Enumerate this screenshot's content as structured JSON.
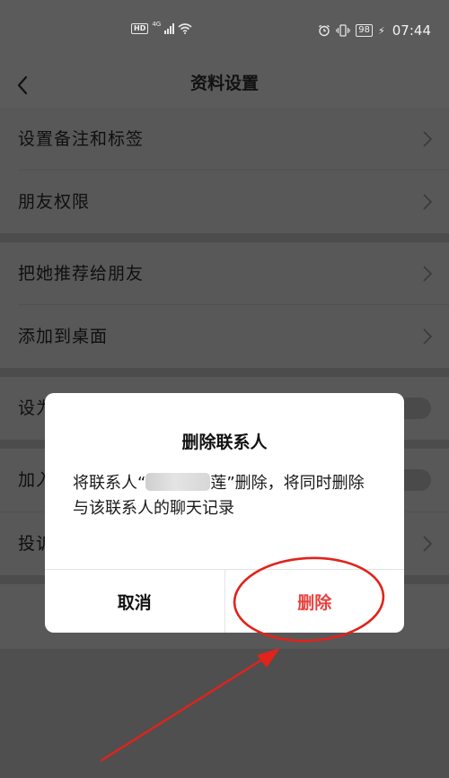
{
  "status_bar": {
    "hd": "HD",
    "network": "4G",
    "battery": "98",
    "time": "07:44"
  },
  "nav": {
    "title": "资料设置",
    "back_icon": "chevron-left-icon"
  },
  "rows": {
    "remark_tags": "设置备注和标签",
    "friend_permissions": "朋友权限",
    "recommend_to_friend": "把她推荐给朋友",
    "add_to_desktop": "添加到桌面",
    "row5_partial": "设为",
    "row6_partial": "加入",
    "row7_partial": "投诉"
  },
  "dialog": {
    "title": "删除联系人",
    "message_prefix": "将联系人“",
    "message_name_tail": "莲",
    "message_suffix": "”删除，将同时删除与该联系人的聊天记录",
    "cancel_label": "取消",
    "delete_label": "删除"
  },
  "colors": {
    "danger": "#e64340",
    "annotation_red": "#e0231b"
  }
}
